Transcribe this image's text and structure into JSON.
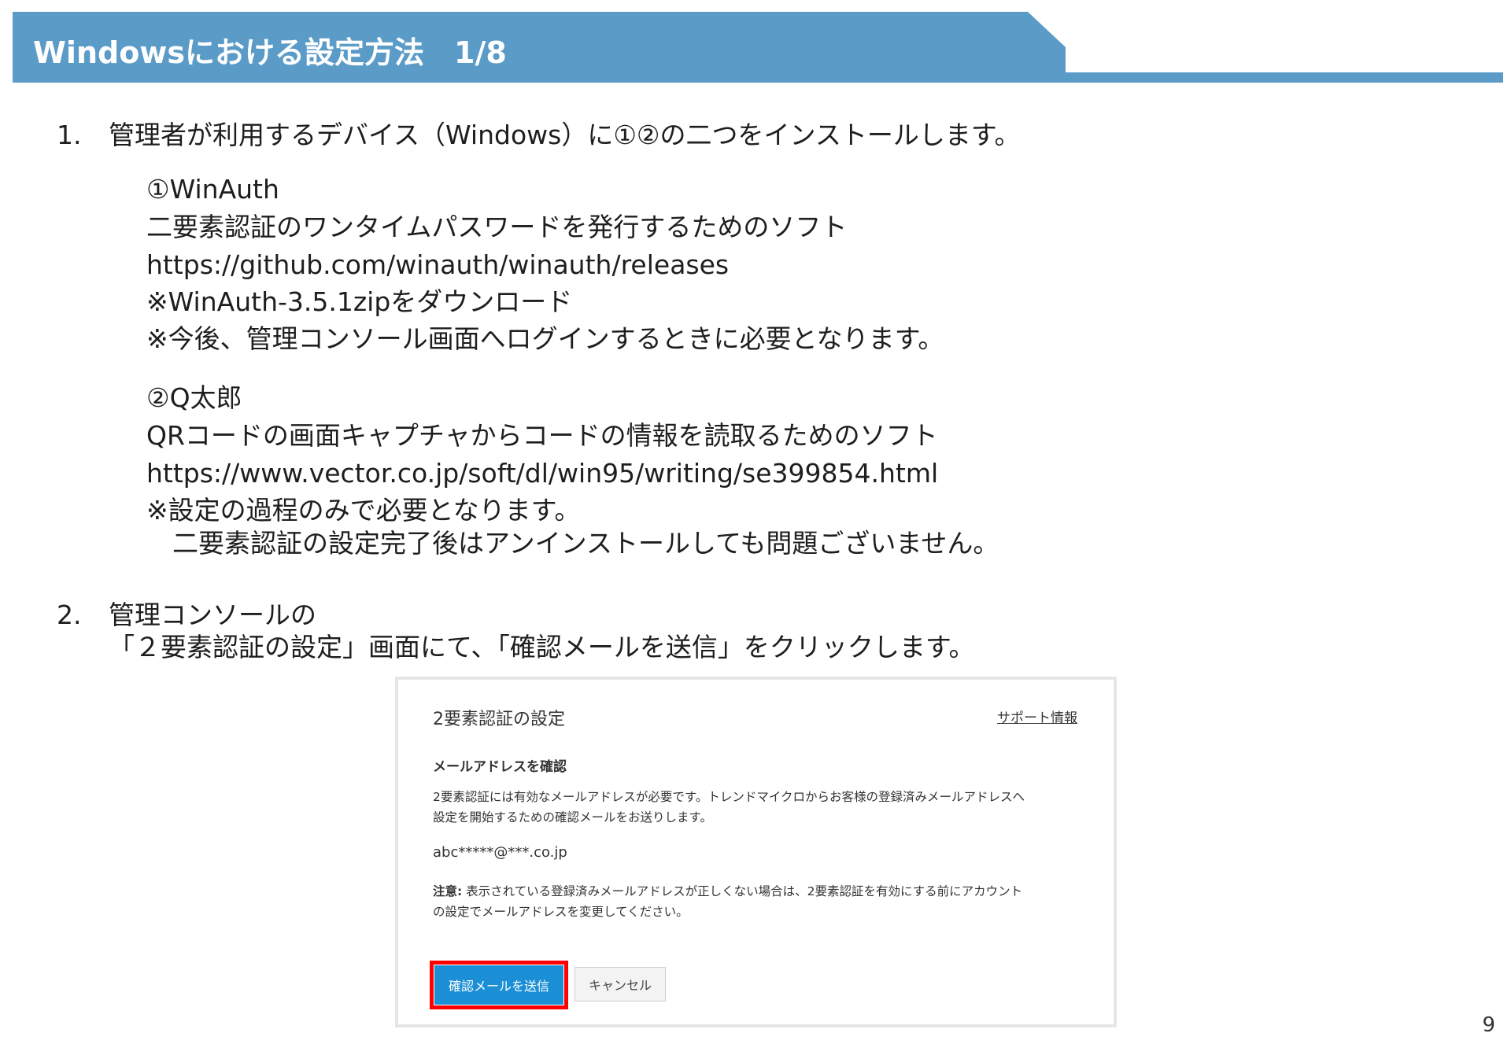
{
  "header": {
    "title": "Windowsにおける設定方法　1/8"
  },
  "steps": [
    {
      "number": "1.",
      "text": "管理者が利用するデバイス（Windows）に①②の二つをインストールします。",
      "items": [
        {
          "lines": [
            "①WinAuth",
            "二要素認証のワンタイムパスワードを発行するためのソフト",
            "https://github.com/winauth/winauth/releases",
            "※WinAuth-3.5.1zipをダウンロード",
            "※今後、管理コンソール画面へログインするときに必要となります。"
          ]
        },
        {
          "lines": [
            "②Q太郎",
            "QRコードの画面キャプチャからコードの情報を読取るためのソフト",
            "https://www.vector.co.jp/soft/dl/win95/writing/se399854.html",
            "※設定の過程のみで必要となります。",
            "　二要素認証の設定完了後はアンインストールしても問題ございません。"
          ]
        }
      ]
    },
    {
      "number": "2.",
      "line1": "管理コンソールの",
      "line2": "「２要素認証の設定」画面にて、「確認メールを送信」をクリックします。"
    }
  ],
  "screenshot": {
    "title": "2要素認証の設定",
    "support_link": "サポート情報",
    "heading": "メールアドレスを確認",
    "body_line1": "2要素認証には有効なメールアドレスが必要です。トレンドマイクロからお客様の登録済みメールアドレスへ",
    "body_line2": "設定を開始するための確認メールをお送りします。",
    "email": "abc*****@***.co.jp",
    "note_label": "注意:",
    "note_line1": " 表示されている登録済みメールアドレスが正しくない場合は、2要素認証を有効にする前にアカウント",
    "note_line2": "の設定でメールアドレスを変更してください。",
    "send_button": "確認メールを送信",
    "cancel_button": "キャンセル"
  },
  "page_number": "9"
}
